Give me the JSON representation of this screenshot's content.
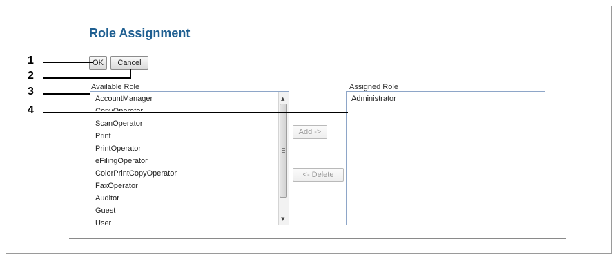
{
  "page": {
    "title": "Role Assignment"
  },
  "buttons": {
    "ok": "OK",
    "cancel": "Cancel",
    "add": "Add ->",
    "delete": "<- Delete"
  },
  "available": {
    "label": "Available Role",
    "items": [
      "AccountManager",
      "CopyOperator",
      "ScanOperator",
      "Print",
      "PrintOperator",
      "eFilingOperator",
      "ColorPrintCopyOperator",
      "FaxOperator",
      "Auditor",
      "Guest",
      "User"
    ]
  },
  "assigned": {
    "label": "Assigned Role",
    "items": [
      "Administrator"
    ]
  },
  "callouts": [
    "1",
    "2",
    "3",
    "4"
  ]
}
